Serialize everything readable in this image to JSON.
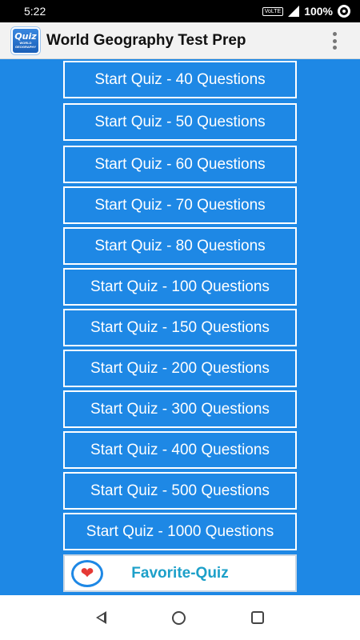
{
  "status_bar": {
    "time": "5:22",
    "volte": "VoLTE",
    "battery": "100%"
  },
  "app_bar": {
    "logo_top": "Quiz",
    "logo_bottom": "WORLD GEOGRAPHY",
    "title": "World Geography Test Prep",
    "menu_icon": "overflow-menu-icon"
  },
  "quiz_buttons": [
    {
      "label": "Start Quiz - 40 Questions"
    },
    {
      "label": "Start Quiz - 50 Questions"
    },
    {
      "label": "Start Quiz - 60 Questions"
    },
    {
      "label": "Start Quiz - 70 Questions"
    },
    {
      "label": "Start Quiz - 80 Questions"
    },
    {
      "label": "Start Quiz - 100 Questions"
    },
    {
      "label": "Start Quiz - 150 Questions"
    },
    {
      "label": "Start Quiz - 200 Questions"
    },
    {
      "label": "Start Quiz - 300 Questions"
    },
    {
      "label": "Start Quiz - 400 Questions"
    },
    {
      "label": "Start Quiz - 500 Questions"
    },
    {
      "label": "Start Quiz - 1000 Questions"
    }
  ],
  "favorite": {
    "label": "Favorite-Quiz",
    "icon": "heart-icon"
  },
  "nav_bar": {
    "back_icon": "back-triangle-icon",
    "home_icon": "home-circle-icon",
    "recents_icon": "recents-square-icon"
  },
  "colors": {
    "background": "#1e88e5",
    "button_border": "#ffffff",
    "favorite_text": "#1da0c9",
    "heart": "#e53935"
  }
}
